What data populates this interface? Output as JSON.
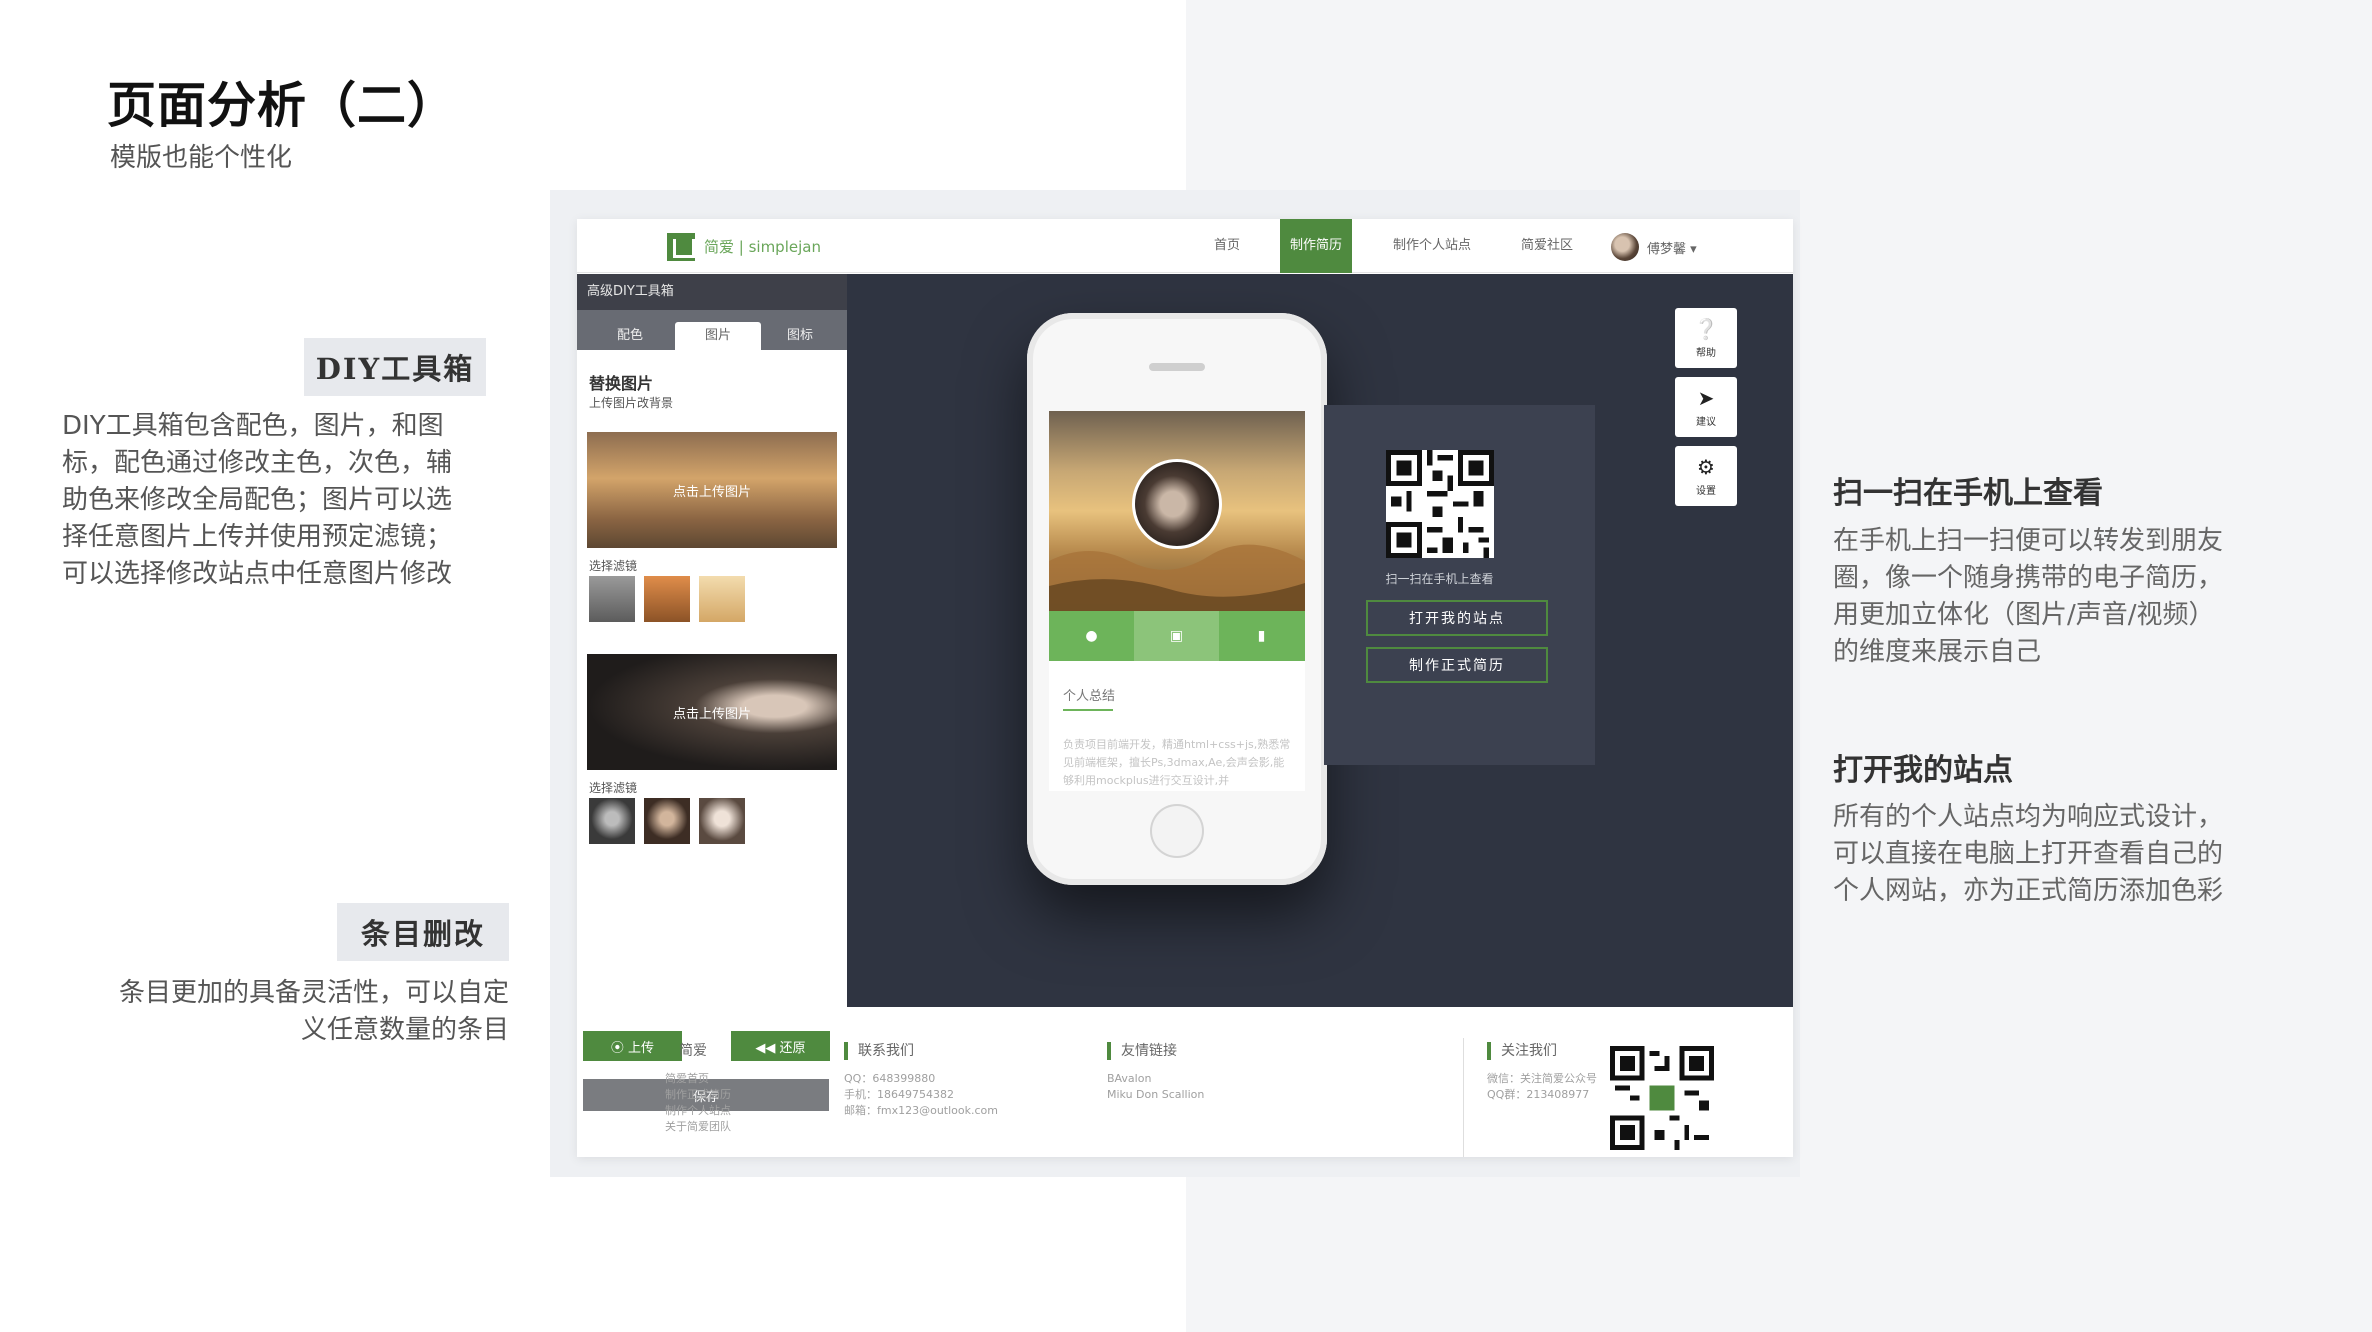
{
  "slide": {
    "title": "页面分析（二）",
    "subtitle": "模版也能个性化"
  },
  "left": {
    "diy_tag": "DIY工具箱",
    "diy_desc": [
      "DIY工具箱包含配色，图片，和图",
      "标，配色通过修改主色，次色，辅",
      "助色来修改全局配色；图片可以选",
      "择任意图片上传并使用预定滤镜；",
      "可以选择修改站点中任意图片修改"
    ],
    "edit_tag": "条目删改",
    "edit_desc": [
      "条目更加的具备灵活性，可以自定",
      "义任意数量的条目"
    ]
  },
  "right": {
    "scan_title": "扫一扫在手机上查看",
    "scan_desc": [
      "在手机上扫一扫便可以转发到朋友",
      "圈，像一个随身携带的电子简历，",
      "用更加立体化（图片/声音/视频）",
      "的维度来展示自己"
    ],
    "open_title": "打开我的站点",
    "open_desc": [
      "所有的个人站点均为响应式设计，",
      "可以直接在电脑上打开查看自己的",
      "个人网站，亦为正式简历添加色彩"
    ]
  },
  "site": {
    "logo": "简爱 | simplejan",
    "nav": [
      "首页",
      "制作简历",
      "制作个人站点",
      "简爱社区"
    ],
    "user": "傅梦馨 ▾",
    "sidebar": {
      "header": "高级DIY工具箱",
      "tabs": [
        "配色",
        "图片",
        "图标"
      ],
      "heading": "替换图片",
      "subheading": "上传图片改背景",
      "upload_label": "点击上传图片",
      "filter_label": "选择滤镜",
      "upload_btn": "⦿ 上传",
      "restore_btn": "◀◀ 还原",
      "save_btn": "保存"
    },
    "phone": {
      "section_title": "个人总结",
      "section_text": "负责项目前端开发，精通html+css+js,熟悉常见前端框架，擅长Ps,3dmax,Ae,会声会影,能够利用mockplus进行交互设计,并"
    },
    "qr": {
      "caption": "扫一扫在手机上查看",
      "open_btn": "打开我的站点",
      "resume_btn": "制作正式简历"
    },
    "float": {
      "help": "帮助",
      "suggest": "建议",
      "settings": "设置"
    },
    "footer": {
      "col1_head": "简爱",
      "col1": [
        "简爱首页",
        "制作正式简历",
        "制作个人站点",
        "关于简爱团队"
      ],
      "col2_head": "联系我们",
      "col2": [
        "QQ：648399880",
        "手机：18649754382",
        "邮箱：fmx123@outlook.com"
      ],
      "col3_head": "友情链接",
      "col3": [
        "BAvalon",
        "Miku Don Scallion"
      ],
      "col4_head": "关注我们",
      "col4": [
        "微信：关注简爱公众号",
        "QQ群：213408977"
      ]
    }
  },
  "colors": {
    "brand_green": "#4f8a3f",
    "light_green": "#6db45a",
    "dark_bg": "#2f3441"
  }
}
